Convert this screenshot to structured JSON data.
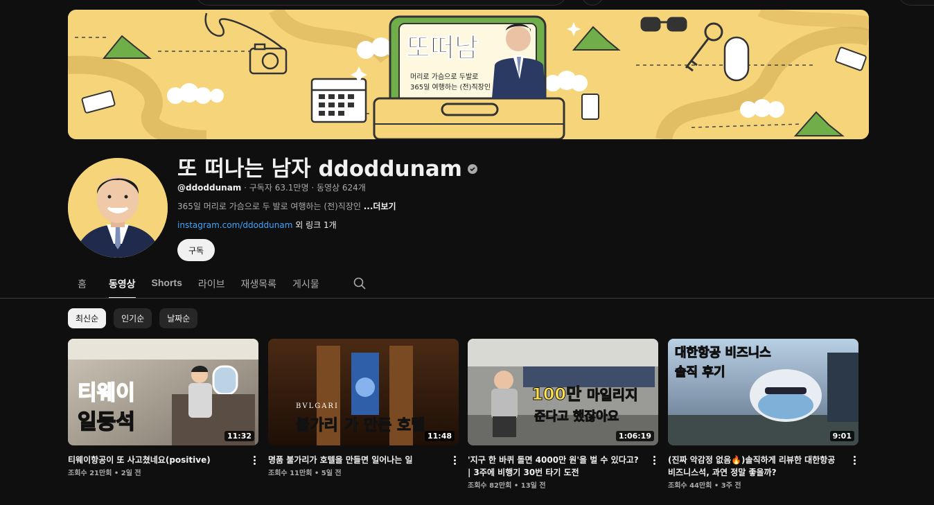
{
  "channel": {
    "name": "또 떠나는 남자 ddoddunam",
    "handle": "@ddoddunam",
    "subscribers": "구독자 63.1만명",
    "video_count": "동영상 624개",
    "description": "365일 머리로 가슴으로 두 발로 여행하는 (전)직장인",
    "more_label": "...더보기",
    "link_text": "instagram.com/ddoddunam",
    "extra_links": "외 링크 1개",
    "subscribe_label": "구독"
  },
  "banner": {
    "logo_text": "또떠남",
    "tagline_line1": "머리로 가슴으로 두발로",
    "tagline_line2": "365일 여행하는 (전)직장인",
    "accent": "#f6d57a"
  },
  "tabs": [
    {
      "label": "홈"
    },
    {
      "label": "동영상"
    },
    {
      "label": "Shorts"
    },
    {
      "label": "라이브"
    },
    {
      "label": "재생목록"
    },
    {
      "label": "게시물"
    }
  ],
  "chips": [
    {
      "label": "최신순"
    },
    {
      "label": "인기순"
    },
    {
      "label": "날짜순"
    }
  ],
  "videos": [
    {
      "title": "티웨이항공이 또 사고쳤네요(positive)",
      "views": "조회수 21만회",
      "age": "2일 전",
      "duration": "11:32",
      "thumb_text1": "티웨이",
      "thumb_text2": "일등석"
    },
    {
      "title": "명품 불가리가 호텔을 만들면 일어나는 일",
      "views": "조회수 11만회",
      "age": "5일 전",
      "duration": "11:48",
      "thumb_text1": "BVLGARI",
      "thumb_text2a": "불가리",
      "thumb_text2b": "가 만든 호텔"
    },
    {
      "title": "'지구 한 바퀴 돌면 4000만 원'을 벌 수 있다고? | 3주에 비행기 30번 타기 도전",
      "views": "조회수 82만회",
      "age": "13일 전",
      "duration": "1:06:19",
      "thumb_text1a": "100만",
      "thumb_text1b": " 마일리지",
      "thumb_text2": "준다고 했잖아요"
    },
    {
      "title": "(진짜 악감정 없음🔥)솔직하게 리뷰한 대한항공 비즈니스석, 과연 정말 좋을까?",
      "views": "조회수 44만회",
      "age": "3주 전",
      "duration": "9:01",
      "thumb_text1": "대한항공 비즈니스",
      "thumb_text2": "솔직 후기"
    }
  ]
}
